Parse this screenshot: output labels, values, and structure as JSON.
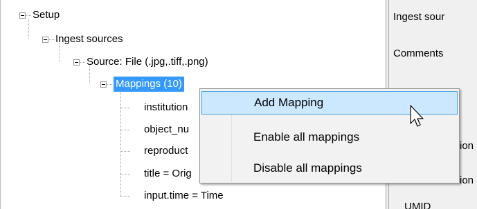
{
  "tree": {
    "root": {
      "label": "Setup"
    },
    "ingest": {
      "label": "Ingest sources"
    },
    "source": {
      "label": "Source: File (.jpg,.tiff,.png)"
    },
    "mappings": {
      "label": "Mappings (10)"
    },
    "children": [
      "institution",
      "object_nu",
      "reproduct",
      "title = Orig",
      "input.time = Time"
    ]
  },
  "right_pane": {
    "ingest_source": "Ingest sour",
    "comments": "Comments",
    "field_a": "ion",
    "field_b": "ion",
    "umid": "UMID"
  },
  "context_menu": {
    "items": [
      "Add Mapping",
      "Enable all mappings",
      "Disable all mappings"
    ],
    "highlighted": "Add Mapping"
  },
  "colors": {
    "selection": "#3399ff",
    "menu_highlight": "#cce8ff",
    "menu_highlight_border": "#3c9fe6"
  },
  "icons": [
    "collapse-icon",
    "mouse-pointer-icon"
  ]
}
